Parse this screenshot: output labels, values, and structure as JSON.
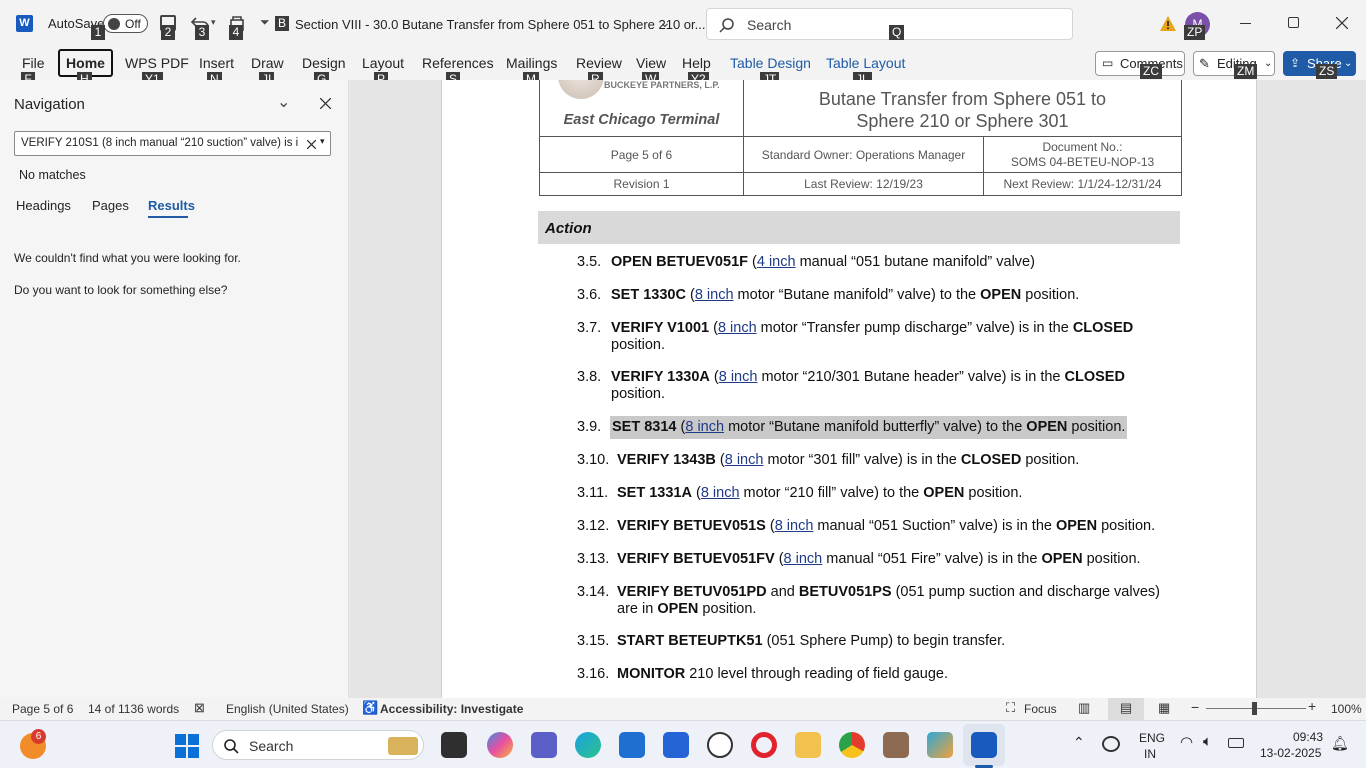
{
  "titlebar": {
    "autosave_label": "AutoSave",
    "autosave_state": "Off",
    "doc_title": "Section VIII - 30.0 Butane Transfer from Sphere 051 to Sphere 210 or...",
    "search_placeholder": "Search",
    "user_initials": "M",
    "keytips": {
      "qat1": "1",
      "qat2": "2",
      "qat3": "3",
      "qat4": "4",
      "qatB": "B",
      "search": "Q",
      "user": "ZP"
    }
  },
  "ribbon": {
    "tabs": [
      {
        "label": "File",
        "key": "F"
      },
      {
        "label": "Home",
        "key": "H"
      },
      {
        "label": "WPS PDF",
        "key": "Y1"
      },
      {
        "label": "Insert",
        "key": "N"
      },
      {
        "label": "Draw",
        "key": "JI"
      },
      {
        "label": "Design",
        "key": "G"
      },
      {
        "label": "Layout",
        "key": "P"
      },
      {
        "label": "References",
        "key": "S"
      },
      {
        "label": "Mailings",
        "key": "M"
      },
      {
        "label": "Review",
        "key": "R"
      },
      {
        "label": "View",
        "key": "W"
      },
      {
        "label": "Help",
        "key": "Y2"
      },
      {
        "label": "Table Design",
        "key": "JT"
      },
      {
        "label": "Table Layout",
        "key": "JL"
      }
    ],
    "comments_label": "Comments",
    "comments_key": "ZC",
    "editing_label": "Editing",
    "editing_key": "ZM",
    "share_label": "Share",
    "share_key": "ZS"
  },
  "navigation": {
    "title": "Navigation",
    "search_value": "VERIFY 210S1 (8 inch manual “210 suction” valve) is i",
    "no_matches": "No matches",
    "tabs": [
      "Headings",
      "Pages",
      "Results"
    ],
    "active_tab": "Results",
    "msg1": "We couldn't find what you were looking for.",
    "msg2": "Do you want to look for something else?"
  },
  "document": {
    "company_logo_text": "BUCKEYE PARTNERS, L.P.",
    "terminal": "East Chicago Terminal",
    "doc_heading_line1": "Butane Transfer from Sphere 051 to",
    "doc_heading_line2": "Sphere 210 or Sphere 301",
    "page_label": "Page 5 of 6",
    "owner": "Standard Owner: Operations Manager",
    "doc_no_label": "Document No.:",
    "doc_no": "SOMS 04-BETEU-NOP-13",
    "revision": "Revision 1",
    "last_review": "Last Review: 12/19/23",
    "next_review": "Next Review: 1/1/24-12/31/24",
    "section_header": "Action",
    "steps": [
      {
        "num": "3.5.",
        "lines": [
          [
            {
              "t": "OPEN BETUEV051F",
              "b": true
            },
            {
              "t": " ("
            },
            {
              "t": "4 inch",
              "u": true
            },
            {
              "t": " manual “051 butane manifold” valve)"
            }
          ]
        ]
      },
      {
        "num": "3.6.",
        "lines": [
          [
            {
              "t": "SET 1330C",
              "b": true
            },
            {
              "t": " ("
            },
            {
              "t": "8 inch",
              "u": true
            },
            {
              "t": " motor “Butane manifold” valve) to the "
            },
            {
              "t": "OPEN",
              "b": true
            },
            {
              "t": " position."
            }
          ]
        ]
      },
      {
        "num": "3.7.",
        "lines": [
          [
            {
              "t": "VERIFY V1001",
              "b": true
            },
            {
              "t": " ("
            },
            {
              "t": "8 inch",
              "u": true
            },
            {
              "t": " motor “Transfer pump discharge” valve) is in the "
            },
            {
              "t": "CLOSED",
              "b": true
            }
          ],
          [
            {
              "t": "position."
            }
          ]
        ]
      },
      {
        "num": "3.8.",
        "lines": [
          [
            {
              "t": "VERIFY 1330A",
              "b": true
            },
            {
              "t": " ("
            },
            {
              "t": "8 inch",
              "u": true
            },
            {
              "t": " motor “210/301 Butane header” valve) is in the "
            },
            {
              "t": "CLOSED",
              "b": true
            }
          ],
          [
            {
              "t": "position."
            }
          ]
        ]
      },
      {
        "num": "3.9.",
        "highlight": true,
        "lines": [
          [
            {
              "t": "SET 8314",
              "b": true
            },
            {
              "t": " ("
            },
            {
              "t": "8 inch",
              "u": true
            },
            {
              "t": " motor “Butane manifold butterfly” valve) to the "
            },
            {
              "t": "OPEN",
              "b": true
            },
            {
              "t": " position."
            }
          ]
        ]
      },
      {
        "num": "3.10.",
        "lines": [
          [
            {
              "t": "VERIFY 1343B",
              "b": true
            },
            {
              "t": " ("
            },
            {
              "t": "8 inch",
              "u": true
            },
            {
              "t": " motor “301 fill” valve) is in the "
            },
            {
              "t": "CLOSED",
              "b": true
            },
            {
              "t": " position."
            }
          ]
        ]
      },
      {
        "num": "3.11.",
        "lines": [
          [
            {
              "t": "SET 1331A",
              "b": true
            },
            {
              "t": " ("
            },
            {
              "t": "8 inch",
              "u": true
            },
            {
              "t": " motor “210 fill” valve) to the "
            },
            {
              "t": "OPEN",
              "b": true
            },
            {
              "t": " position."
            }
          ]
        ]
      },
      {
        "num": "3.12.",
        "lines": [
          [
            {
              "t": "VERIFY BETUEV051S",
              "b": true
            },
            {
              "t": " ("
            },
            {
              "t": "8 inch",
              "u": true
            },
            {
              "t": " manual “051 Suction” valve) is in the "
            },
            {
              "t": "OPEN",
              "b": true
            },
            {
              "t": " position."
            }
          ]
        ]
      },
      {
        "num": "3.13.",
        "lines": [
          [
            {
              "t": "VERIFY BETUEV051FV",
              "b": true
            },
            {
              "t": " ("
            },
            {
              "t": "8 inch",
              "u": true
            },
            {
              "t": " manual “051 Fire” valve) is in the "
            },
            {
              "t": "OPEN",
              "b": true
            },
            {
              "t": " position."
            }
          ]
        ]
      },
      {
        "num": "3.14.",
        "lines": [
          [
            {
              "t": "VERIFY BETUV051PD",
              "b": true
            },
            {
              "t": " and "
            },
            {
              "t": "BETUV051PS",
              "b": true
            },
            {
              "t": " (051 pump suction and discharge valves)"
            }
          ],
          [
            {
              "t": "are in "
            },
            {
              "t": "OPEN",
              "b": true
            },
            {
              "t": " position."
            }
          ]
        ]
      },
      {
        "num": "3.15.",
        "lines": [
          [
            {
              "t": "START BETEUPTK51",
              "b": true
            },
            {
              "t": " (051 Sphere Pump) to begin transfer."
            }
          ]
        ]
      },
      {
        "num": "3.16.",
        "lines": [
          [
            {
              "t": "MONITOR",
              "b": true
            },
            {
              "t": " 210 level through reading of field gauge."
            }
          ]
        ]
      }
    ]
  },
  "statusbar": {
    "page": "Page 5 of 6",
    "words": "14 of 1136 words",
    "language": "English (United States)",
    "accessibility": "Accessibility: Investigate",
    "focus": "Focus",
    "zoom": "100%"
  },
  "taskbar": {
    "notif_count": "6",
    "search_label": "Search",
    "language": "ENG",
    "region": "IN",
    "time": "09:43",
    "date": "13-02-2025"
  }
}
